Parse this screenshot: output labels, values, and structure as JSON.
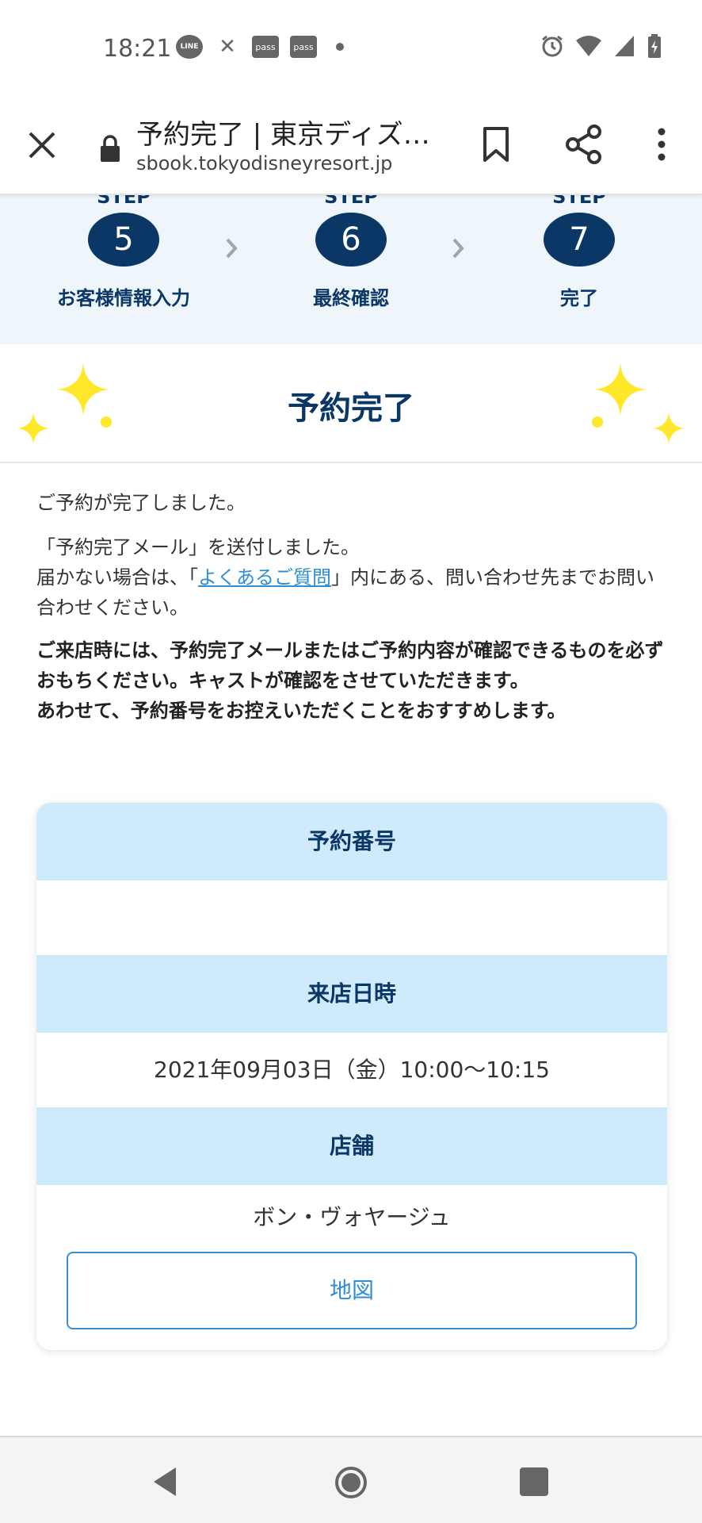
{
  "status_bar": {
    "time": "18:21",
    "notif_icons": [
      "line-icon",
      "x-icon",
      "pass-icon",
      "pass-icon",
      "dot-icon"
    ],
    "line_label": "LINE",
    "pass_label": "pass",
    "right_icons": [
      "alarm-icon",
      "wifi-icon",
      "signal-icon",
      "battery-icon"
    ]
  },
  "browser": {
    "title": "予約完了 | 東京ディズ…",
    "url": "sbook.tokyodisneyresort.jp"
  },
  "steps": {
    "top_label": "STEP",
    "items": [
      {
        "number": "5",
        "name": "お客様情報入力"
      },
      {
        "number": "6",
        "name": "最終確認"
      },
      {
        "number": "7",
        "name": "完了"
      }
    ]
  },
  "done": {
    "title": "予約完了"
  },
  "message": {
    "line1": "ご予約が完了しました。",
    "line2": "「予約完了メール」を送付しました。",
    "line3_pre": "届かない場合は、「",
    "faq_link": "よくあるご質問",
    "line3_post": "」内にある、問い合わせ先までお問い合わせください。",
    "bold1": "ご来店時には、予約完了メールまたはご予約内容が確認できるものを必ずおもちください。キャストが確認をさせていただきます。",
    "bold2": "あわせて、予約番号をお控えいただくことをおすすめします。"
  },
  "card": {
    "reservation_no_label": "予約番号",
    "visit_label": "来店日時",
    "visit_value": "2021年09月03日（金）10:00〜10:15",
    "store_label": "店舗",
    "store_value": "ボン・ヴォヤージュ",
    "map_button": "地図"
  },
  "colors": {
    "navy": "#0a3765",
    "light_blue": "#cfeafb",
    "link": "#2f8fd4",
    "sparkle": "#ffe82a"
  }
}
